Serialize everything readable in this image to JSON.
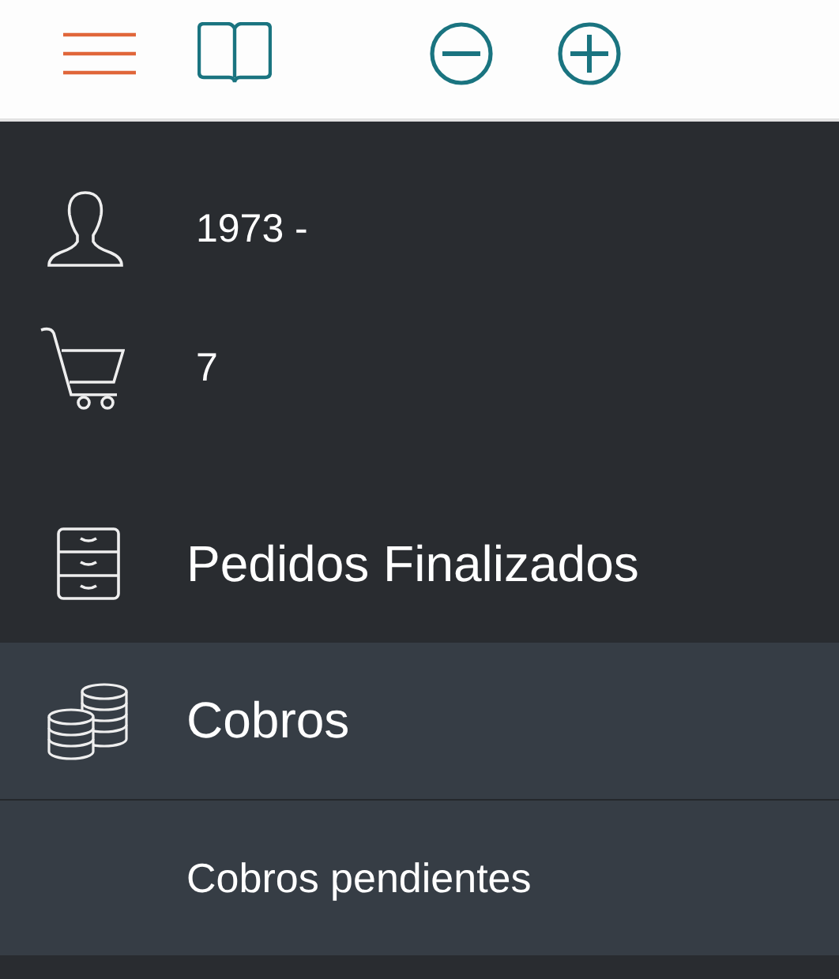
{
  "profile": {
    "user": "1973 -",
    "cart_count": "7"
  },
  "menu": [
    {
      "label": "Pedidos Finalizados",
      "kind": "drawers",
      "expanded": false
    },
    {
      "label": "Cobros",
      "kind": "coins",
      "expanded": true,
      "children": [
        {
          "label": "Cobros pendientes"
        }
      ]
    }
  ]
}
